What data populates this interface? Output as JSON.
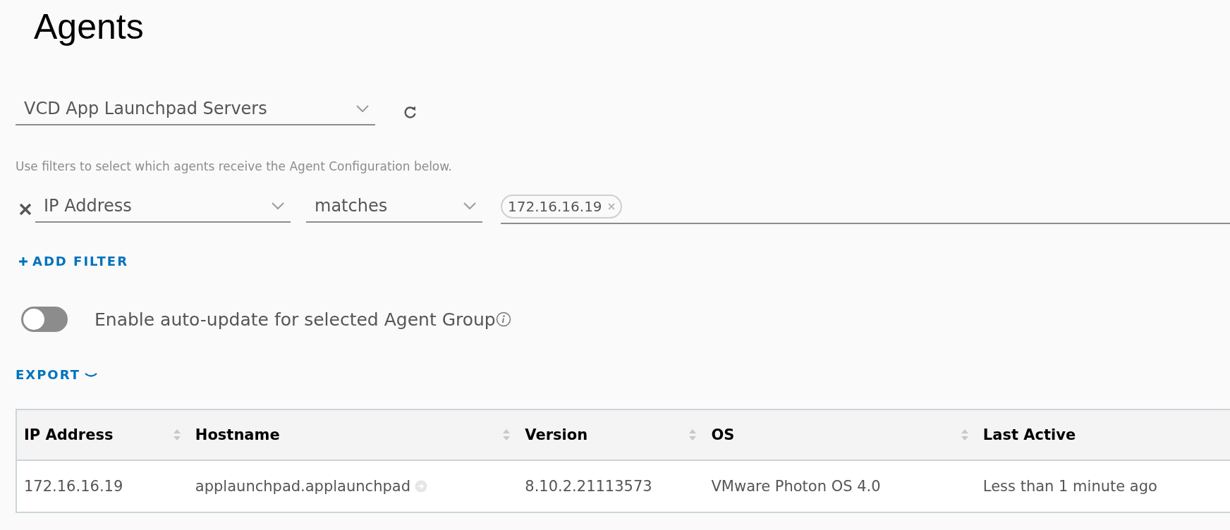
{
  "page": {
    "title": "Agents"
  },
  "group_select": {
    "value": "VCD App Launchpad Servers"
  },
  "filters": {
    "hint": "Use filters to select which agents receive the Agent Configuration below.",
    "rows": [
      {
        "field": "IP Address",
        "operator": "matches",
        "values": [
          "172.16.16.19"
        ]
      }
    ],
    "add_label": "ADD FILTER"
  },
  "auto_update": {
    "label": "Enable auto-update for selected Agent Group",
    "on": false
  },
  "export": {
    "label": "EXPORT"
  },
  "table": {
    "columns": [
      {
        "label": "IP Address",
        "sortable": true
      },
      {
        "label": "Hostname",
        "sortable": true
      },
      {
        "label": "Version",
        "sortable": true
      },
      {
        "label": "OS",
        "sortable": true
      },
      {
        "label": "Last Active",
        "sortable": false
      }
    ],
    "rows": [
      {
        "cells": [
          {
            "text": "172.16.16.19",
            "kind": "text"
          },
          {
            "text": "applaunchpad.applaunchpad",
            "kind": "link"
          },
          {
            "text": "8.10.2.21113573",
            "kind": "text"
          },
          {
            "text": "VMware Photon OS 4.0",
            "kind": "text"
          },
          {
            "text": "Less than 1 minute ago",
            "kind": "text"
          }
        ]
      }
    ]
  }
}
